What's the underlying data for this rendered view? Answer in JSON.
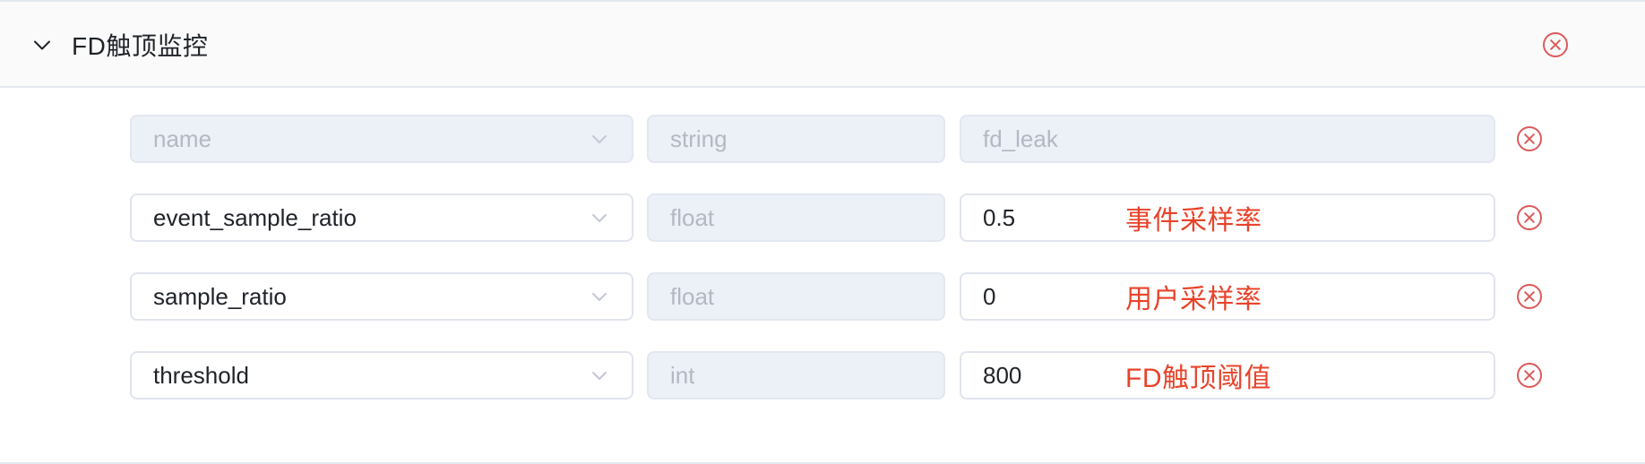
{
  "panel": {
    "title": "FD触顶监控",
    "collapse_icon": "chevron-down-icon",
    "remove_icon": "circle-close-icon",
    "accent_red": "#e8432a",
    "icon_red": "#dd5a5a",
    "header_bg": "#fafafa",
    "border_color": "#e3e8f0",
    "disabled_bg": "#ecf0f7",
    "placeholder_color": "#b3b8c2",
    "text_color": "#1f2329"
  },
  "rows": [
    {
      "name": "name",
      "name_is_placeholder": true,
      "name_disabled": true,
      "type": "string",
      "type_is_placeholder": true,
      "type_disabled": true,
      "value": "fd_leak",
      "value_is_placeholder": true,
      "value_disabled": true,
      "annotation": "",
      "remove_icon": "circle-close-icon"
    },
    {
      "name": "event_sample_ratio",
      "name_is_placeholder": false,
      "name_disabled": false,
      "type": "float",
      "type_is_placeholder": true,
      "type_disabled": true,
      "value": "0.5",
      "value_is_placeholder": false,
      "value_disabled": false,
      "annotation": "事件采样率",
      "remove_icon": "circle-close-icon"
    },
    {
      "name": "sample_ratio",
      "name_is_placeholder": false,
      "name_disabled": false,
      "type": "float",
      "type_is_placeholder": true,
      "type_disabled": true,
      "value": "0",
      "value_is_placeholder": false,
      "value_disabled": false,
      "annotation": "用户采样率",
      "remove_icon": "circle-close-icon"
    },
    {
      "name": "threshold",
      "name_is_placeholder": false,
      "name_disabled": false,
      "type": "int",
      "type_is_placeholder": true,
      "type_disabled": true,
      "value": "800",
      "value_is_placeholder": false,
      "value_disabled": false,
      "annotation": "FD触顶阈值",
      "remove_icon": "circle-close-icon"
    }
  ]
}
